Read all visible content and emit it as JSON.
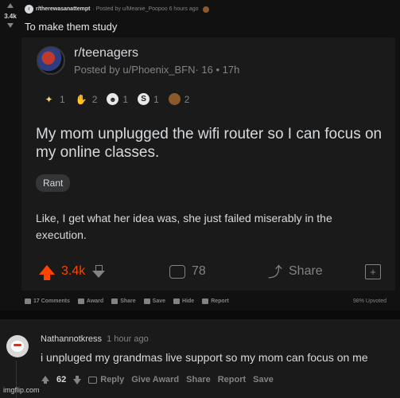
{
  "outer_post": {
    "score": "3.4k",
    "subreddit": "r/therewasanattempt",
    "posted_by": "· Posted by u/Meanie_Poopoo 6 hours ago",
    "title": "To make them study"
  },
  "card": {
    "subreddit": "r/teenagers",
    "posted_by": "Posted by u/Phoenix_BFN· 16 • 17h",
    "awards": [
      {
        "icon": "wholesome-award-icon",
        "count": "1"
      },
      {
        "icon": "hands-award-icon",
        "count": "2"
      },
      {
        "icon": "face-award-icon",
        "count": "1"
      },
      {
        "icon": "silver-award-icon",
        "count": "1"
      },
      {
        "icon": "poop-award-icon",
        "count": "2"
      }
    ],
    "headline": "My mom unplugged the wifi router so I can focus on my online classes.",
    "flair": "Rant",
    "body": "Like, I get what her idea was, she just failed miserably in the execution.",
    "score": "3.4k",
    "comments": "78",
    "share": "Share",
    "colors": {
      "upvote": "#ff4500",
      "muted": "#818384",
      "text": "#d7dadc"
    }
  },
  "action_bar": {
    "comments": "17 Comments",
    "award": "Award",
    "share": "Share",
    "save": "Save",
    "hide": "Hide",
    "report": "Report",
    "upvoted": "98% Upvoted"
  },
  "comment": {
    "user": "Nathannotkress",
    "time": "1 hour ago",
    "body": "i unpluged my grandmas live support so my mom can focus on me",
    "score": "62",
    "reply": "Reply",
    "give_award": "Give Award",
    "share": "Share",
    "report": "Report",
    "save": "Save"
  },
  "watermark": "imgflip.com"
}
